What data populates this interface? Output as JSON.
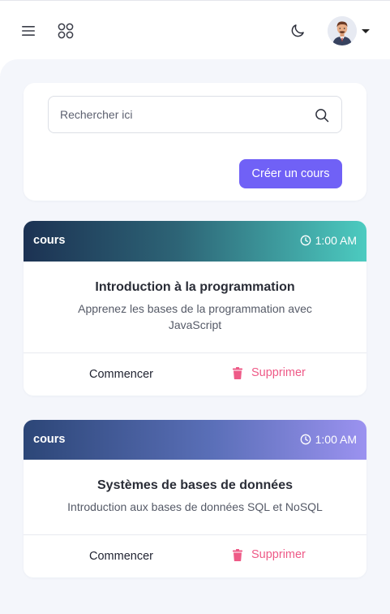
{
  "header": {
    "menu_icon": "hamburger-menu-icon",
    "apps_icon": "apps-grid-icon",
    "theme_icon": "moon-icon",
    "avatar_icon": "user-avatar",
    "dropdown_icon": "caret-down-icon"
  },
  "search": {
    "placeholder": "Rechercher ici",
    "value": "",
    "icon": "search-icon",
    "create_label": "Créer un cours"
  },
  "colors": {
    "accent": "#7061f6",
    "danger": "#ee5a87",
    "background": "#f4f6fb"
  },
  "courses": [
    {
      "tag": "cours",
      "time": "1:00 AM",
      "title": "Introduction à la programmation",
      "description": "Apprenez les bases de la programmation avec JavaScript",
      "start_label": "Commencer",
      "delete_label": "Supprimer"
    },
    {
      "tag": "cours",
      "time": "1:00 AM",
      "title": "Systèmes de bases de données",
      "description": "Introduction aux bases de données SQL et NoSQL",
      "start_label": "Commencer",
      "delete_label": "Supprimer"
    }
  ]
}
